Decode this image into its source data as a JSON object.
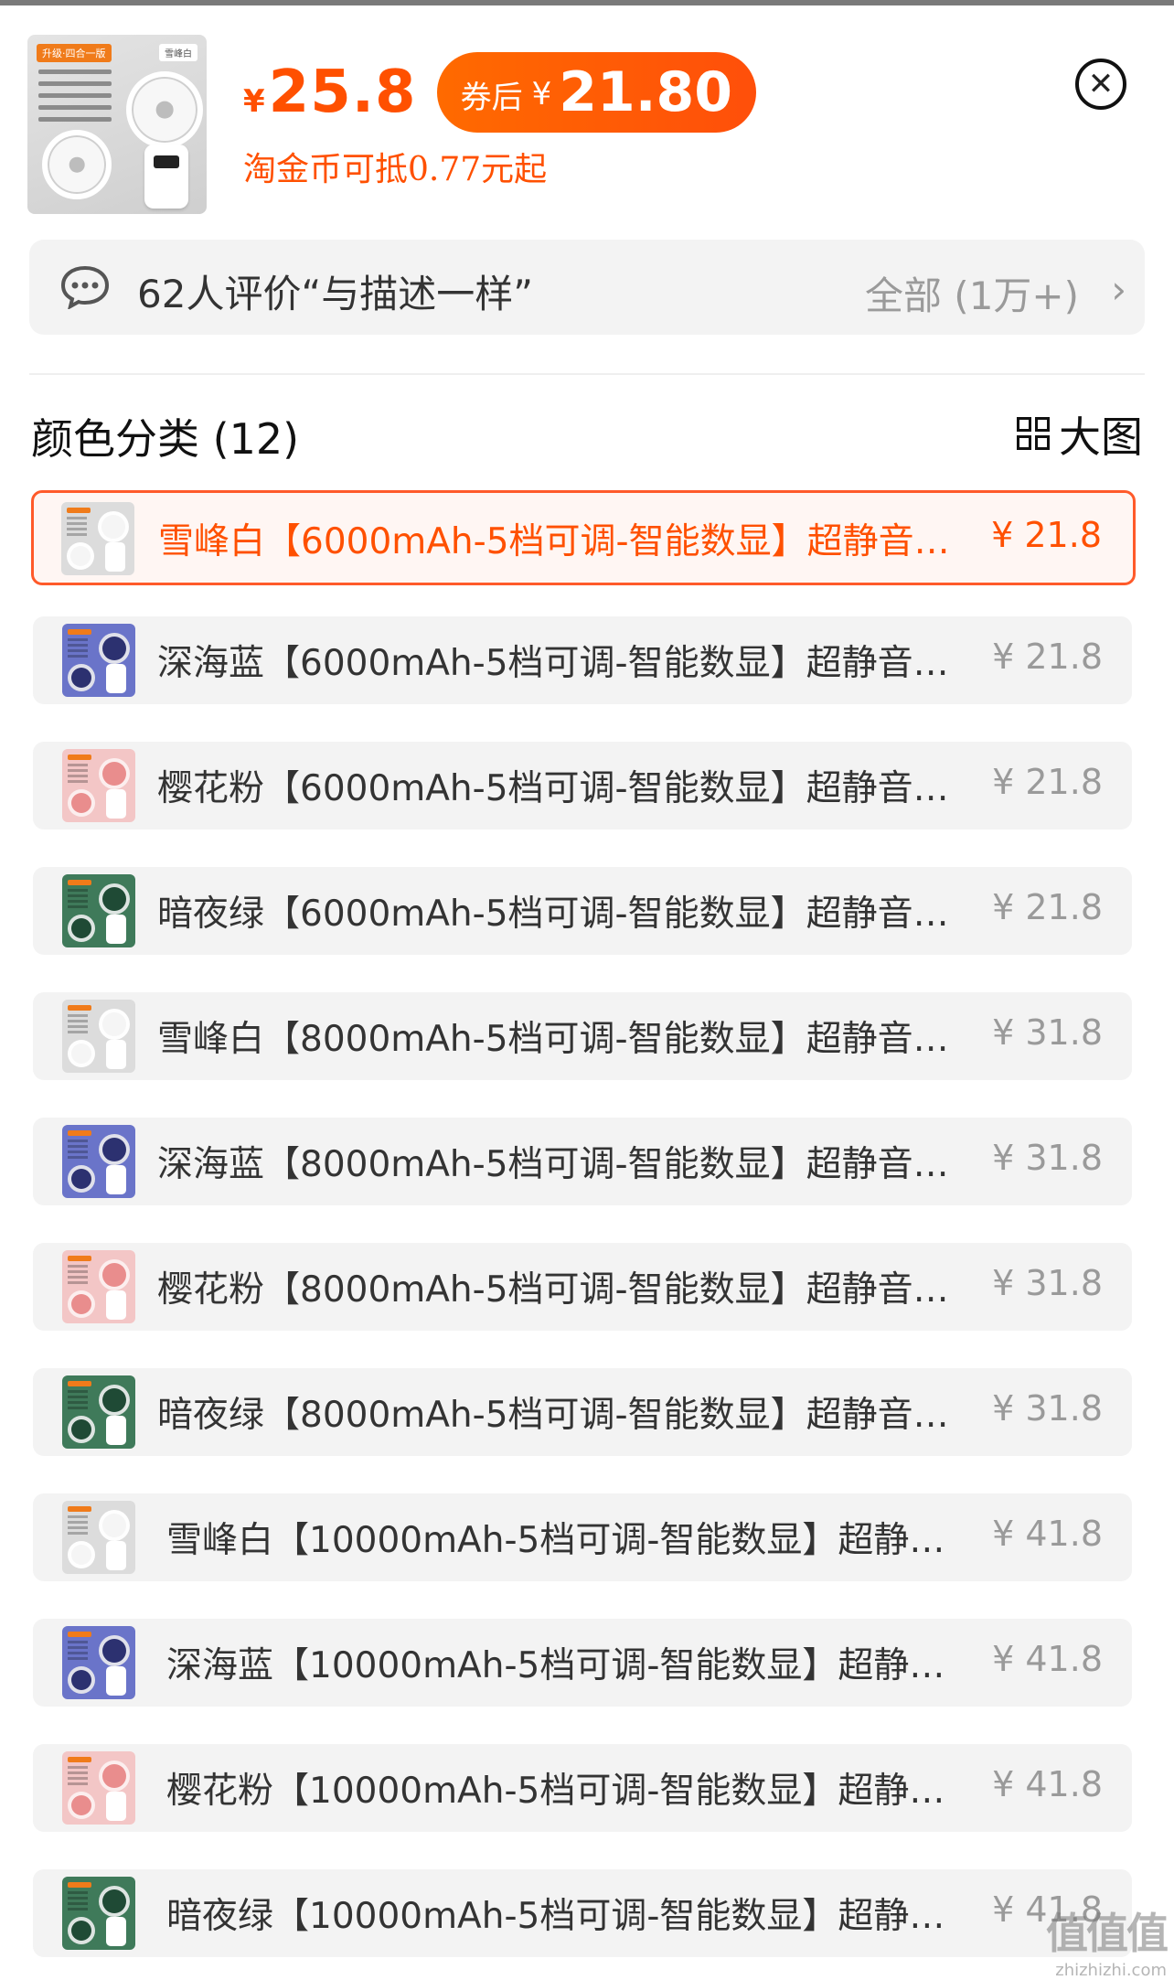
{
  "header": {
    "product_thumb": {
      "tag": "升级·四合一版",
      "tag_right": "雪峰白",
      "accent": "#f07b1a"
    },
    "price_currency": "¥",
    "price": "25.8",
    "coupon_label": "券后",
    "coupon_currency": "¥",
    "coupon_price": "21.80",
    "coins_text": "淘金币可抵0.77元起",
    "close_icon": "close-icon",
    "accent_color": "#ff5000"
  },
  "reviews": {
    "icon": "chat-bubble-icon",
    "text": "62人评价“与描述一样”",
    "all_label": "全部 (1万+)",
    "chevron": "›"
  },
  "section": {
    "title": "颜色分类 (12)",
    "bigpic_label": "大图",
    "bigpic_icon": "grid-icon"
  },
  "variants": [
    {
      "name": "雪峰白【6000mAh-5档可调-智能数显】超静音…",
      "price": "¥ 21.8",
      "color": "white",
      "selected": true
    },
    {
      "name": "深海蓝【6000mAh-5档可调-智能数显】超静音…",
      "price": "¥ 21.8",
      "color": "blue",
      "selected": false
    },
    {
      "name": "樱花粉【6000mAh-5档可调-智能数显】超静音…",
      "price": "¥ 21.8",
      "color": "pink",
      "selected": false
    },
    {
      "name": "暗夜绿【6000mAh-5档可调-智能数显】超静音…",
      "price": "¥ 21.8",
      "color": "green",
      "selected": false
    },
    {
      "name": "雪峰白【8000mAh-5档可调-智能数显】超静音…",
      "price": "¥ 31.8",
      "color": "white",
      "selected": false
    },
    {
      "name": "深海蓝【8000mAh-5档可调-智能数显】超静音…",
      "price": "¥ 31.8",
      "color": "blue",
      "selected": false
    },
    {
      "name": "樱花粉【8000mAh-5档可调-智能数显】超静音…",
      "price": "¥ 31.8",
      "color": "pink",
      "selected": false
    },
    {
      "name": "暗夜绿【8000mAh-5档可调-智能数显】超静音…",
      "price": "¥ 31.8",
      "color": "green",
      "selected": false
    },
    {
      "name": "雪峰白【10000mAh-5档可调-智能数显】超静…",
      "price": "¥ 41.8",
      "color": "white",
      "selected": false
    },
    {
      "name": "深海蓝【10000mAh-5档可调-智能数显】超静…",
      "price": "¥ 41.8",
      "color": "blue",
      "selected": false
    },
    {
      "name": "樱花粉【10000mAh-5档可调-智能数显】超静…",
      "price": "¥ 41.8",
      "color": "pink",
      "selected": false
    },
    {
      "name": "暗夜绿【10000mAh-5档可调-智能数显】超静…",
      "price": "¥ 41.8",
      "color": "green",
      "selected": false
    }
  ],
  "variant_colors": {
    "white": {
      "bg": "#dcdcdc",
      "fan": "#f5f5f5"
    },
    "blue": {
      "bg": "#6a74c9",
      "fan": "#2c3170"
    },
    "pink": {
      "bg": "#f3c6c6",
      "fan": "#e98d8d"
    },
    "green": {
      "bg": "#3f7a5a",
      "fan": "#1f4a35"
    }
  },
  "watermark": {
    "logo": "值值值",
    "url": "zhizhizhi.com"
  }
}
